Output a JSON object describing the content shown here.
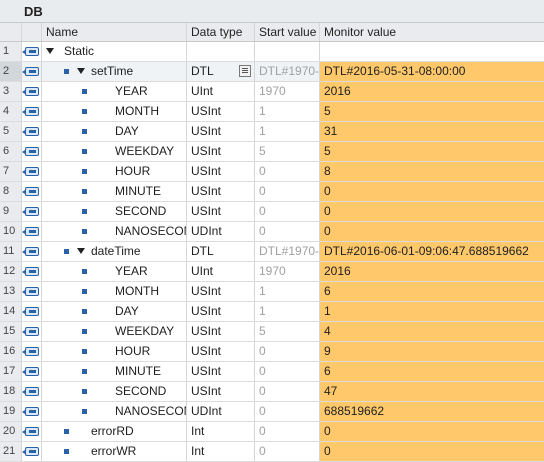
{
  "title": "DB",
  "columns": {
    "name": "Name",
    "data_type": "Data type",
    "start_value": "Start value",
    "monitor_value": "Monitor value"
  },
  "rows": [
    {
      "num": "1",
      "name": "Static",
      "type": "",
      "start": "",
      "monitor": "",
      "level": 0,
      "toggle": true,
      "square": false,
      "fill": false
    },
    {
      "num": "2",
      "name": "setTime",
      "type": "DTL",
      "start": "DTL#1970-",
      "monitor": "DTL#2016-05-31-08:00:00",
      "level": 1,
      "toggle": true,
      "square": true,
      "fill": true,
      "picker": true,
      "selected": true
    },
    {
      "num": "3",
      "name": "YEAR",
      "type": "UInt",
      "start": "1970",
      "monitor": "2016",
      "level": 2,
      "toggle": false,
      "square": true,
      "fill": true
    },
    {
      "num": "4",
      "name": "MONTH",
      "type": "USInt",
      "start": "1",
      "monitor": "5",
      "level": 2,
      "toggle": false,
      "square": true,
      "fill": true
    },
    {
      "num": "5",
      "name": "DAY",
      "type": "USInt",
      "start": "1",
      "monitor": "31",
      "level": 2,
      "toggle": false,
      "square": true,
      "fill": true
    },
    {
      "num": "6",
      "name": "WEEKDAY",
      "type": "USInt",
      "start": "5",
      "monitor": "5",
      "level": 2,
      "toggle": false,
      "square": true,
      "fill": true
    },
    {
      "num": "7",
      "name": "HOUR",
      "type": "USInt",
      "start": "0",
      "monitor": "8",
      "level": 2,
      "toggle": false,
      "square": true,
      "fill": true
    },
    {
      "num": "8",
      "name": "MINUTE",
      "type": "USInt",
      "start": "0",
      "monitor": "0",
      "level": 2,
      "toggle": false,
      "square": true,
      "fill": true
    },
    {
      "num": "9",
      "name": "SECOND",
      "type": "USInt",
      "start": "0",
      "monitor": "0",
      "level": 2,
      "toggle": false,
      "square": true,
      "fill": true
    },
    {
      "num": "10",
      "name": "NANOSECOND",
      "type": "UDInt",
      "start": "0",
      "monitor": "0",
      "level": 2,
      "toggle": false,
      "square": true,
      "fill": true
    },
    {
      "num": "11",
      "name": "dateTime",
      "type": "DTL",
      "start": "DTL#1970-",
      "monitor": "DTL#2016-06-01-09:06:47.688519662",
      "level": 1,
      "toggle": true,
      "square": true,
      "fill": true
    },
    {
      "num": "12",
      "name": "YEAR",
      "type": "UInt",
      "start": "1970",
      "monitor": "2016",
      "level": 2,
      "toggle": false,
      "square": true,
      "fill": true
    },
    {
      "num": "13",
      "name": "MONTH",
      "type": "USInt",
      "start": "1",
      "monitor": "6",
      "level": 2,
      "toggle": false,
      "square": true,
      "fill": true
    },
    {
      "num": "14",
      "name": "DAY",
      "type": "USInt",
      "start": "1",
      "monitor": "1",
      "level": 2,
      "toggle": false,
      "square": true,
      "fill": true
    },
    {
      "num": "15",
      "name": "WEEKDAY",
      "type": "USInt",
      "start": "5",
      "monitor": "4",
      "level": 2,
      "toggle": false,
      "square": true,
      "fill": true
    },
    {
      "num": "16",
      "name": "HOUR",
      "type": "USInt",
      "start": "0",
      "monitor": "9",
      "level": 2,
      "toggle": false,
      "square": true,
      "fill": true
    },
    {
      "num": "17",
      "name": "MINUTE",
      "type": "USInt",
      "start": "0",
      "monitor": "6",
      "level": 2,
      "toggle": false,
      "square": true,
      "fill": true
    },
    {
      "num": "18",
      "name": "SECOND",
      "type": "USInt",
      "start": "0",
      "monitor": "47",
      "level": 2,
      "toggle": false,
      "square": true,
      "fill": true
    },
    {
      "num": "19",
      "name": "NANOSECOND",
      "type": "UDInt",
      "start": "0",
      "monitor": "688519662",
      "level": 2,
      "toggle": false,
      "square": true,
      "fill": true
    },
    {
      "num": "20",
      "name": "errorRD",
      "type": "Int",
      "start": "0",
      "monitor": "0",
      "level": 1,
      "toggle": false,
      "square": true,
      "fill": true
    },
    {
      "num": "21",
      "name": "errorWR",
      "type": "Int",
      "start": "0",
      "monitor": "0",
      "level": 1,
      "toggle": false,
      "square": true,
      "fill": true
    }
  ],
  "colors": {
    "monitor_fill": "#ffc96b",
    "accent": "#2a62a8"
  }
}
